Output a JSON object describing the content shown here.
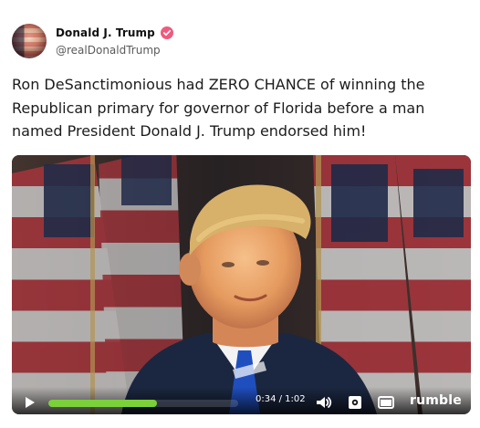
{
  "post": {
    "author": {
      "display_name": "Donald J. Trump",
      "handle": "@realDonaldTrump",
      "verified_color": "#f05a7e"
    },
    "text": "Ron DeSanctimonious had ZERO CHANCE of winning the Republican primary for governor of Florida before a man named President Donald J. Trump endorsed him!"
  },
  "video": {
    "time_text": "0:34 / 1:02",
    "progress": 0.57,
    "progress_color": "#7bd13a",
    "brand": "rumble",
    "icons": {
      "play": "play-icon",
      "volume": "volume-icon",
      "settings": "gear-icon",
      "pip": "picture-in-picture-icon"
    }
  }
}
